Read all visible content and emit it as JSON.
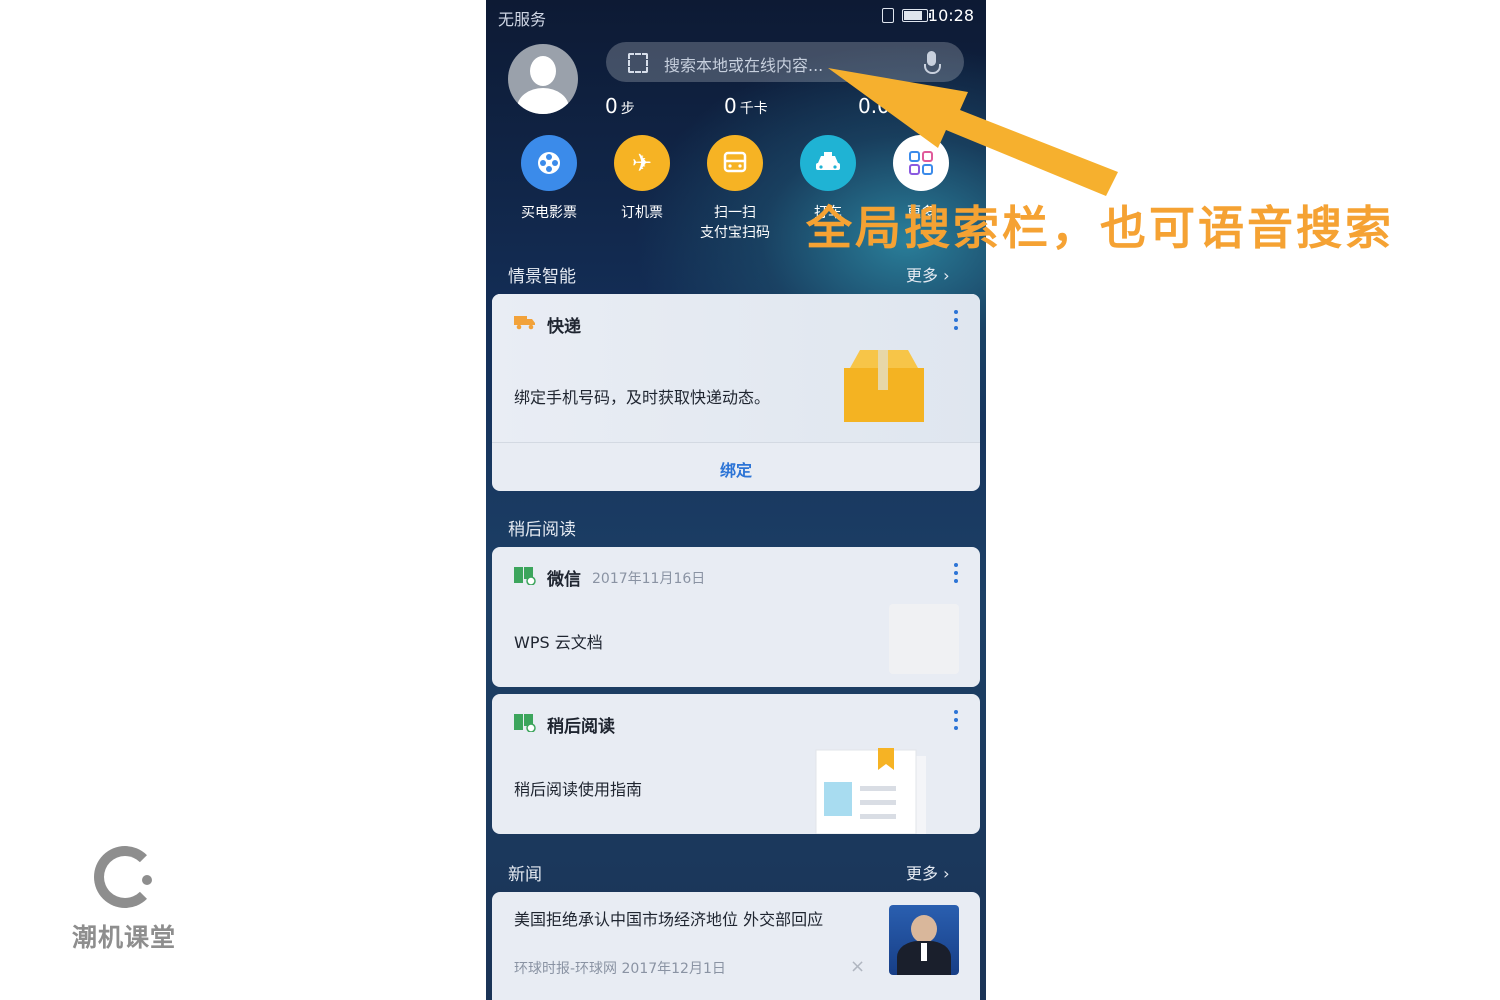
{
  "status": {
    "carrier": "无服务",
    "time": "10:28"
  },
  "search": {
    "placeholder": "搜索本地或在线内容..."
  },
  "stats": [
    {
      "value": "0",
      "unit": "步"
    },
    {
      "value": "0",
      "unit": "千卡"
    },
    {
      "value": "0.0",
      "unit": ""
    }
  ],
  "shortcuts": [
    {
      "label": "买电影票",
      "icon": "film-reel-icon",
      "color": "#3b8bea"
    },
    {
      "label": "订机票",
      "icon": "airplane-icon",
      "color": "#f6b324"
    },
    {
      "label": "扫一扫\n支付宝扫码",
      "icon": "scan-bus-icon",
      "color": "#f6b324"
    },
    {
      "label": "打车",
      "icon": "taxi-icon",
      "color": "#1fb3d4"
    },
    {
      "label": "更多",
      "icon": "apps-grid-icon",
      "color": "#ffffff"
    }
  ],
  "sections": {
    "smart": {
      "title": "情景智能",
      "more": "更多"
    },
    "later": {
      "title": "稍后阅读"
    },
    "news": {
      "title": "新闻",
      "more": "更多"
    }
  },
  "cards": {
    "express": {
      "title": "快递",
      "body": "绑定手机号码，及时获取快递动态。",
      "action": "绑定"
    },
    "wechat": {
      "title": "微信",
      "date": "2017年11月16日",
      "body": "WPS 云文档"
    },
    "readlater": {
      "title": "稍后阅读",
      "body": "稍后阅读使用指南"
    },
    "news": {
      "title": "美国拒绝承认中国市场经济地位 外交部回应",
      "meta": "环球时报-环球网 2017年12月1日"
    }
  },
  "annotation": {
    "text": "全局搜索栏，也可语音搜索",
    "color": "#f5a233"
  },
  "watermark": {
    "text": "潮机课堂"
  }
}
